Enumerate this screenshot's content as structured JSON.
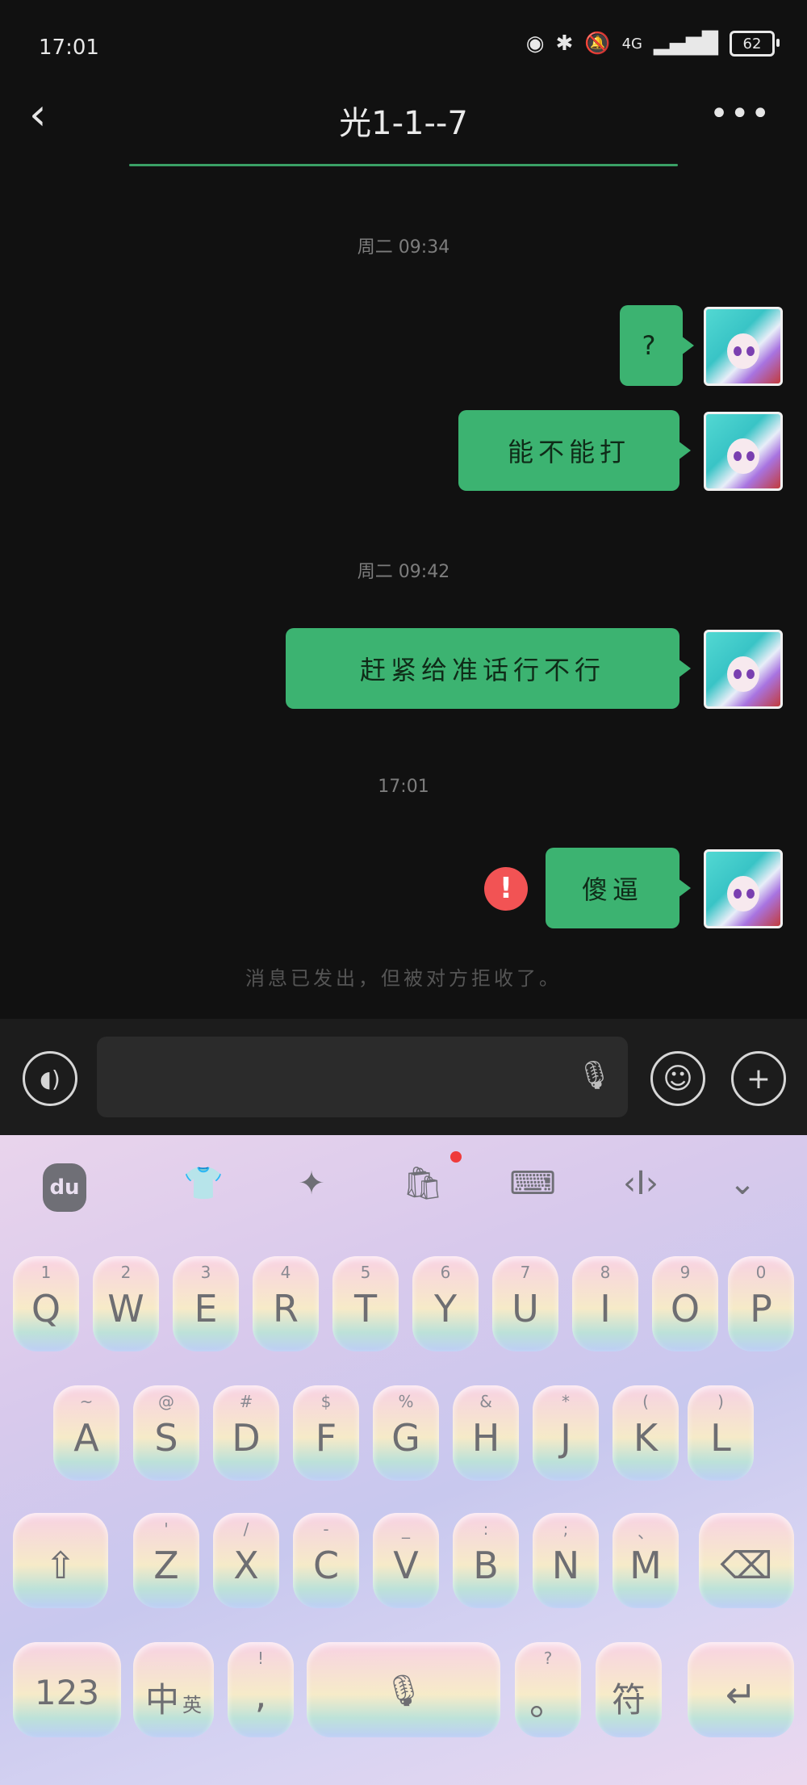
{
  "status_bar": {
    "time": "17:01",
    "network": "4G",
    "battery": "62"
  },
  "header": {
    "back_icon": "chevron-left-icon",
    "title": "光1-1--7",
    "more_icon": "more-dots-icon"
  },
  "messages": {
    "ts1": "周二 09:34",
    "ts2": "周二 09:42",
    "ts3": "17:01",
    "m1": "?",
    "m2": "能不能打",
    "m3": "赶紧给准话行不行",
    "m4": "傻逼",
    "system_notice": "消息已发出，但被对方拒收了。"
  },
  "input_bar": {
    "placeholder": ""
  },
  "keyboard": {
    "row1": [
      {
        "main": "Q",
        "sub": "1"
      },
      {
        "main": "W",
        "sub": "2"
      },
      {
        "main": "E",
        "sub": "3"
      },
      {
        "main": "R",
        "sub": "4"
      },
      {
        "main": "T",
        "sub": "5"
      },
      {
        "main": "Y",
        "sub": "6"
      },
      {
        "main": "U",
        "sub": "7"
      },
      {
        "main": "I",
        "sub": "8"
      },
      {
        "main": "O",
        "sub": "9"
      },
      {
        "main": "P",
        "sub": "0"
      }
    ],
    "row2": [
      {
        "main": "A",
        "sub": "~"
      },
      {
        "main": "S",
        "sub": "@"
      },
      {
        "main": "D",
        "sub": "#"
      },
      {
        "main": "F",
        "sub": "$"
      },
      {
        "main": "G",
        "sub": "%"
      },
      {
        "main": "H",
        "sub": "&"
      },
      {
        "main": "J",
        "sub": "*"
      },
      {
        "main": "K",
        "sub": "("
      },
      {
        "main": "L",
        "sub": ")"
      }
    ],
    "row3": [
      {
        "main": "Z",
        "sub": "'"
      },
      {
        "main": "X",
        "sub": "/"
      },
      {
        "main": "C",
        "sub": "-"
      },
      {
        "main": "V",
        "sub": "_"
      },
      {
        "main": "B",
        "sub": ":"
      },
      {
        "main": "N",
        "sub": ";"
      },
      {
        "main": "M",
        "sub": "、"
      }
    ],
    "bottom": {
      "num": "123",
      "lang": "中",
      "lang_sub": "英",
      "comma": ",",
      "comma_sub": "!",
      "period": "。",
      "period_sub": "?",
      "symbols": "符"
    }
  }
}
